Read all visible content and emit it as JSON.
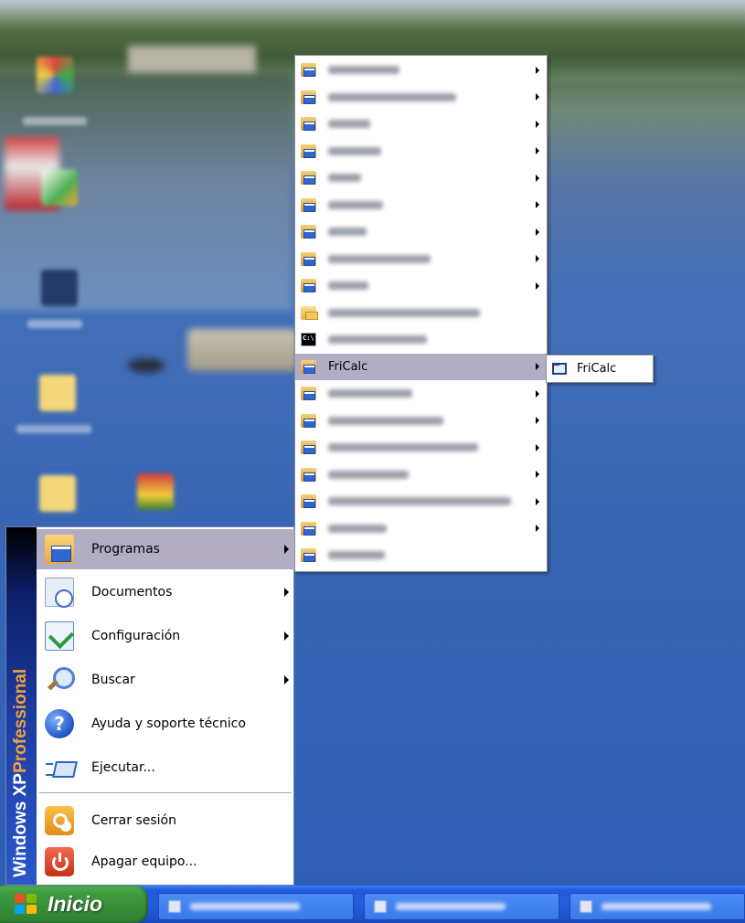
{
  "start_menu": {
    "band_brand": "Windows XP",
    "band_edition": "Professional",
    "items": [
      {
        "label": "Programas",
        "icon": "programs-folder-icon",
        "submenu": true,
        "highlighted": true
      },
      {
        "label": "Documentos",
        "icon": "documents-icon",
        "submenu": true
      },
      {
        "label": "Configuración",
        "icon": "settings-icon",
        "submenu": true
      },
      {
        "label": "Buscar",
        "icon": "search-icon",
        "submenu": true
      },
      {
        "label": "Ayuda y soporte técnico",
        "icon": "help-icon"
      },
      {
        "label": "Ejecutar...",
        "icon": "run-icon"
      },
      {
        "label": "Cerrar sesión",
        "icon": "logoff-icon"
      },
      {
        "label": "Apagar equipo...",
        "icon": "shutdown-icon"
      }
    ]
  },
  "programs_menu": {
    "items": [
      {
        "label": "",
        "icon": "program-group-icon",
        "submenu": true
      },
      {
        "label": "",
        "icon": "program-group-icon",
        "submenu": true
      },
      {
        "label": "",
        "icon": "program-group-icon",
        "submenu": true
      },
      {
        "label": "",
        "icon": "program-group-icon",
        "submenu": true
      },
      {
        "label": "",
        "icon": "program-group-icon",
        "submenu": true
      },
      {
        "label": "",
        "icon": "program-group-icon",
        "submenu": true
      },
      {
        "label": "",
        "icon": "program-group-icon",
        "submenu": true
      },
      {
        "label": "",
        "icon": "program-group-icon",
        "submenu": true
      },
      {
        "label": "",
        "icon": "program-group-icon",
        "submenu": true
      },
      {
        "label": "",
        "icon": "explorer-folder-icon",
        "submenu": false
      },
      {
        "label": "",
        "icon": "command-prompt-icon",
        "submenu": false
      },
      {
        "label": "FriCalc",
        "icon": "program-group-icon",
        "submenu": true,
        "highlighted": true
      },
      {
        "label": "",
        "icon": "program-group-icon",
        "submenu": true
      },
      {
        "label": "",
        "icon": "program-group-icon",
        "submenu": true
      },
      {
        "label": "",
        "icon": "program-group-icon",
        "submenu": true
      },
      {
        "label": "",
        "icon": "program-group-icon",
        "submenu": true
      },
      {
        "label": "",
        "icon": "program-group-icon",
        "submenu": true
      },
      {
        "label": "",
        "icon": "program-group-icon",
        "submenu": true
      },
      {
        "label": "",
        "icon": "program-group-icon",
        "submenu": false
      }
    ]
  },
  "fricalc_menu": {
    "items": [
      {
        "label": "FriCalc",
        "icon": "fricalc-app-icon"
      }
    ]
  },
  "taskbar": {
    "start_label": "Inicio",
    "task_button_count": 3
  },
  "colors": {
    "menu_highlight": "#b3adc4",
    "taskbar_blue": "#245ddb",
    "start_green": "#388f39",
    "band_edition": "#f0a23a"
  }
}
